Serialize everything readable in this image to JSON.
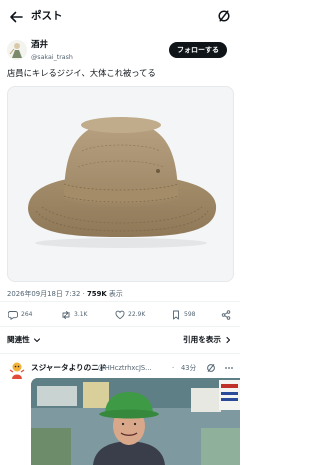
{
  "header": {
    "title": "ポスト",
    "back_icon": "arrow-left-icon",
    "grok_icon": "grok-icon"
  },
  "author": {
    "name": "酒井",
    "handle": "@sakai_trash",
    "follow_label": "フォローする"
  },
  "tweet": {
    "text": "店員にキレるジジイ、大体これ被ってる",
    "media_description": "bucket-hat-image",
    "timestamp": "2026年09月18日 7:32",
    "separator": " · ",
    "views": "759K",
    "views_label": " 表示"
  },
  "actions": {
    "reply_count": "264",
    "retweet_count": "3.1K",
    "like_count": "22.9K",
    "bookmark_count": "598"
  },
  "sort": {
    "left_label": "関連性",
    "right_label": "引用を表示"
  },
  "reply": {
    "name": "スジャータよりのニド",
    "handle": "@HHcztrhxcJS...",
    "dot": "·",
    "time": "43分"
  },
  "colors": {
    "text_primary": "#0f1419",
    "text_secondary": "#536471",
    "follow_bg": "#0f1419",
    "divider": "#eff3f4"
  }
}
